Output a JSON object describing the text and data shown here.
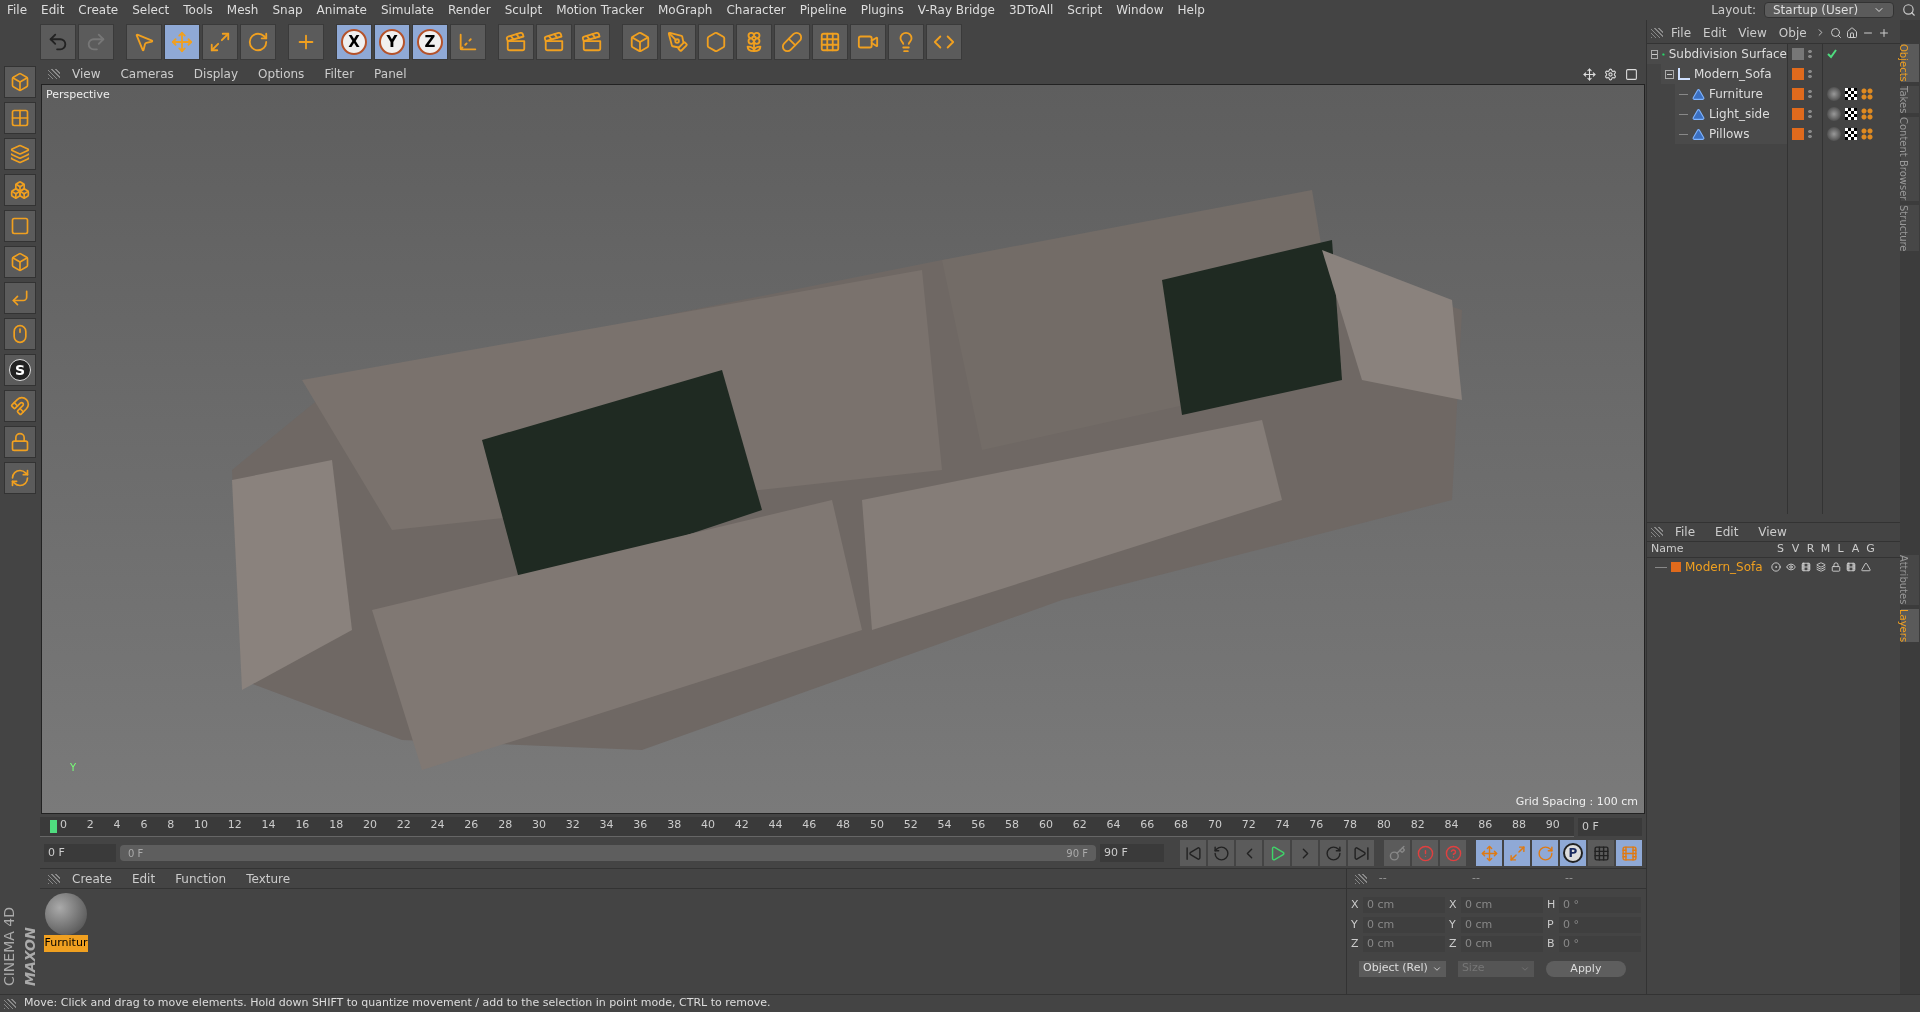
{
  "menu": [
    "File",
    "Edit",
    "Create",
    "Select",
    "Tools",
    "Mesh",
    "Snap",
    "Animate",
    "Simulate",
    "Render",
    "Sculpt",
    "Motion Tracker",
    "MoGraph",
    "Character",
    "Pipeline",
    "Plugins",
    "V-Ray Bridge",
    "3DToAll",
    "Script",
    "Window",
    "Help"
  ],
  "layout": {
    "label": "Layout:",
    "value": "Startup (User)"
  },
  "toolbar": [
    {
      "kind": "undo",
      "selected": false
    },
    {
      "kind": "redo",
      "selected": false
    },
    {
      "kind": "sep"
    },
    {
      "kind": "select",
      "selected": false
    },
    {
      "kind": "move",
      "selected": true
    },
    {
      "kind": "scale",
      "selected": false
    },
    {
      "kind": "rotate",
      "selected": false
    },
    {
      "kind": "sep"
    },
    {
      "kind": "add",
      "selected": false
    },
    {
      "kind": "sep"
    },
    {
      "kind": "axis",
      "label": "X",
      "selected": true
    },
    {
      "kind": "axis",
      "label": "Y",
      "selected": true
    },
    {
      "kind": "axis",
      "label": "Z",
      "selected": true
    },
    {
      "kind": "coords",
      "selected": false
    },
    {
      "kind": "sep"
    },
    {
      "kind": "clapper",
      "selected": false
    },
    {
      "kind": "clapper",
      "selected": false
    },
    {
      "kind": "clapper",
      "selected": false
    },
    {
      "kind": "sep"
    },
    {
      "kind": "cube",
      "selected": false
    },
    {
      "kind": "pen",
      "selected": false
    },
    {
      "kind": "subdiv",
      "selected": false
    },
    {
      "kind": "cloner",
      "selected": false
    },
    {
      "kind": "deformer",
      "selected": false
    },
    {
      "kind": "floor",
      "selected": false
    },
    {
      "kind": "camera",
      "selected": false
    },
    {
      "kind": "light",
      "selected": false
    },
    {
      "kind": "python",
      "selected": false
    }
  ],
  "left_tools": [
    {
      "kind": "cube"
    },
    {
      "kind": "checker"
    },
    {
      "kind": "layers"
    },
    {
      "kind": "points"
    },
    {
      "kind": "edges"
    },
    {
      "kind": "polys"
    },
    {
      "kind": "axis"
    },
    {
      "kind": "mouse"
    },
    {
      "kind": "snap",
      "label": "S"
    },
    {
      "kind": "magnet"
    },
    {
      "kind": "lockgrid"
    },
    {
      "kind": "gridrot"
    }
  ],
  "viewport": {
    "menu": [
      "View",
      "Cameras",
      "Display",
      "Options",
      "Filter",
      "Panel"
    ],
    "label": "Perspective",
    "grid_spacing": "Grid Spacing : 100 cm",
    "axis_label": "Y"
  },
  "timeline": {
    "ruler": [
      "0",
      "2",
      "4",
      "6",
      "8",
      "10",
      "12",
      "14",
      "16",
      "18",
      "20",
      "22",
      "24",
      "26",
      "28",
      "30",
      "32",
      "34",
      "36",
      "38",
      "40",
      "42",
      "44",
      "46",
      "48",
      "50",
      "52",
      "54",
      "56",
      "58",
      "60",
      "62",
      "64",
      "66",
      "68",
      "70",
      "72",
      "74",
      "76",
      "78",
      "80",
      "82",
      "84",
      "86",
      "88",
      "90"
    ],
    "level": 0,
    "current_frame": "0 F",
    "start": "0 F",
    "range_start": "0 F",
    "range_end": "90 F",
    "end": "90 F",
    "buttons": [
      {
        "kind": "first"
      },
      {
        "kind": "prevkey"
      },
      {
        "kind": "prev"
      },
      {
        "kind": "play"
      },
      {
        "kind": "next"
      },
      {
        "kind": "nextkey"
      },
      {
        "kind": "last"
      },
      {
        "kind": "recordoff"
      },
      {
        "kind": "record"
      },
      {
        "kind": "auto"
      },
      {
        "kind": "kmove",
        "selected": true
      },
      {
        "kind": "kscale",
        "selected": true
      },
      {
        "kind": "krot",
        "selected": true
      },
      {
        "kind": "kparam",
        "label": "P",
        "selected": true
      },
      {
        "kind": "kpla",
        "selected": false
      },
      {
        "kind": "film",
        "selected": true
      }
    ]
  },
  "materials": {
    "menu": [
      "Create",
      "Edit",
      "Function",
      "Texture"
    ],
    "items": [
      {
        "name": "Furnitur",
        "selected": true
      }
    ]
  },
  "brand": {
    "top": "MAXON",
    "bottom": "CINEMA 4D"
  },
  "coordinates": {
    "headers": [
      "--",
      "--",
      "--"
    ],
    "rows": [
      [
        {
          "axis": "X",
          "value": "0 cm"
        },
        {
          "axis": "X",
          "value": "0 cm"
        },
        {
          "axis": "H",
          "value": "0 °"
        }
      ],
      [
        {
          "axis": "Y",
          "value": "0 cm"
        },
        {
          "axis": "Y",
          "value": "0 cm"
        },
        {
          "axis": "P",
          "value": "0 °"
        }
      ],
      [
        {
          "axis": "Z",
          "value": "0 cm"
        },
        {
          "axis": "Z",
          "value": "0 cm"
        },
        {
          "axis": "B",
          "value": "0 °"
        }
      ]
    ],
    "mode": "Object (Rel)",
    "size": {
      "label": "Size",
      "disabled": true
    },
    "apply": "Apply"
  },
  "objects": {
    "menu": [
      "File",
      "Edit",
      "View",
      "Obje"
    ],
    "tree": [
      {
        "name": "Subdivision Surface",
        "kind": "subdiv",
        "children": [
          {
            "name": "Modern_Sofa",
            "kind": "null",
            "children": [
              {
                "name": "Furniture",
                "kind": "poly"
              },
              {
                "name": "Light_side",
                "kind": "poly"
              },
              {
                "name": "Pillows",
                "kind": "poly"
              }
            ]
          }
        ]
      }
    ]
  },
  "layers": {
    "menu": [
      "File",
      "Edit",
      "View"
    ],
    "columns": [
      "Name",
      "S",
      "V",
      "R",
      "M",
      "L",
      "A",
      "G"
    ],
    "rows": [
      {
        "name": "Modern_Sofa",
        "color": "#e06a1c"
      }
    ]
  },
  "side_tabs": [
    {
      "label": "Objects",
      "selected": true
    },
    {
      "label": "Takes",
      "selected": false
    },
    {
      "label": "Content Browser",
      "selected": false
    },
    {
      "label": "Structure",
      "selected": false
    },
    {
      "label": "Attributes",
      "selected": false
    },
    {
      "label": "Layers",
      "selected": true
    }
  ],
  "status": "Move: Click and drag to move elements. Hold down SHIFT to quantize movement / add to the selection in point mode, CTRL to remove."
}
